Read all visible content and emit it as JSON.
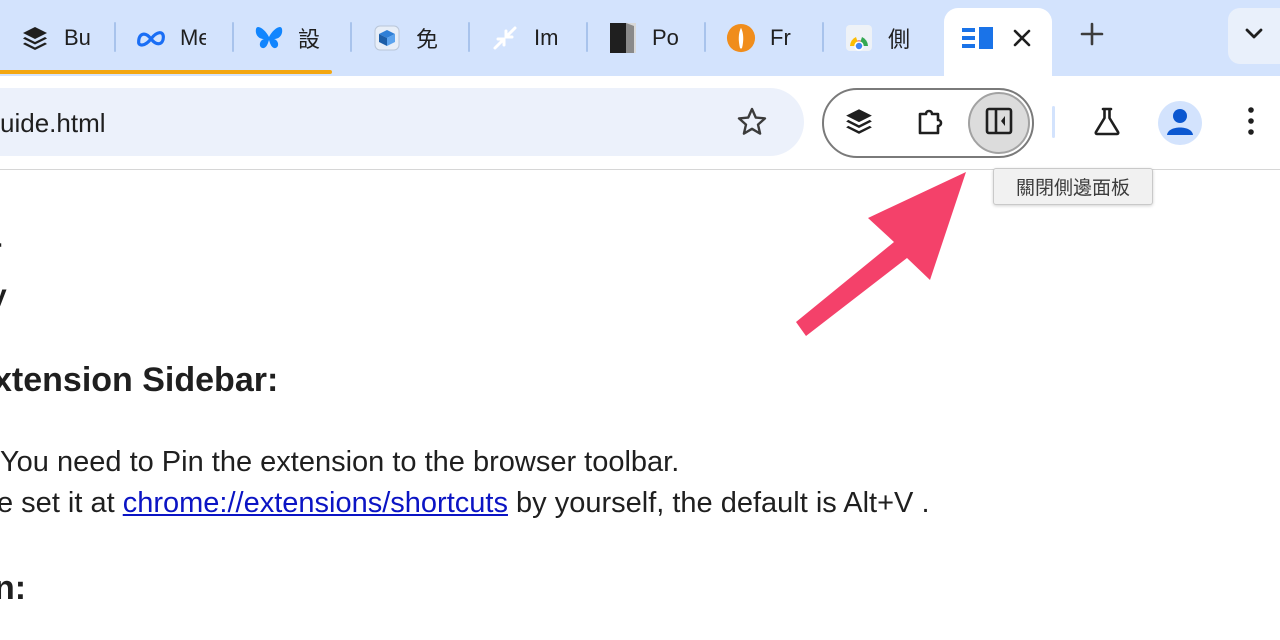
{
  "tabs": [
    {
      "label": "Bu",
      "icon": "stacked-layers-icon"
    },
    {
      "label": "Me",
      "icon": "meta-logo-icon"
    },
    {
      "label": "設",
      "icon": "butterfly-icon"
    },
    {
      "label": "免",
      "icon": "cube-package-icon"
    },
    {
      "label": "Im",
      "icon": "compress-arrows-icon"
    },
    {
      "label": "Po",
      "icon": "book-icon"
    },
    {
      "label": "Fr",
      "icon": "orange-circle-icon"
    },
    {
      "label": "側",
      "icon": "chrome-logo-icon"
    }
  ],
  "active_tab": {
    "icon": "sidebar-layout-icon",
    "close_icon": "close-icon"
  },
  "new_tab_icon": "plus-icon",
  "tab_search_icon": "chevron-down-icon",
  "omnibox": {
    "url": "uide.html",
    "bookmark_icon": "star-icon"
  },
  "toolbar": {
    "pinned_extension_icon": "stacked-layers-icon",
    "extensions_icon": "puzzle-icon",
    "side_panel_icon": "side-panel-icon",
    "labs_icon": "flask-icon",
    "profile_icon": "avatar-icon",
    "menu_icon": "kebab-menu-icon"
  },
  "tooltip": "關閉側邊面板",
  "content": {
    "fragment_1": "r",
    "fragment_2": "y",
    "heading": "xtension Sidebar:",
    "line_1": " You need to Pin the extension to the browser toolbar.",
    "line_2_prefix": "e set it at ",
    "line_2_link": "chrome://extensions/shortcuts",
    "line_2_suffix": " by yourself, the default is Alt+V .",
    "fragment_3": "n:"
  },
  "colors": {
    "tab_strip": "#d3e3fd",
    "omnibox": "#ecf1fb",
    "tab_underline": "#f3a712",
    "link": "#0b14c4",
    "arrow": "#f4416a"
  }
}
